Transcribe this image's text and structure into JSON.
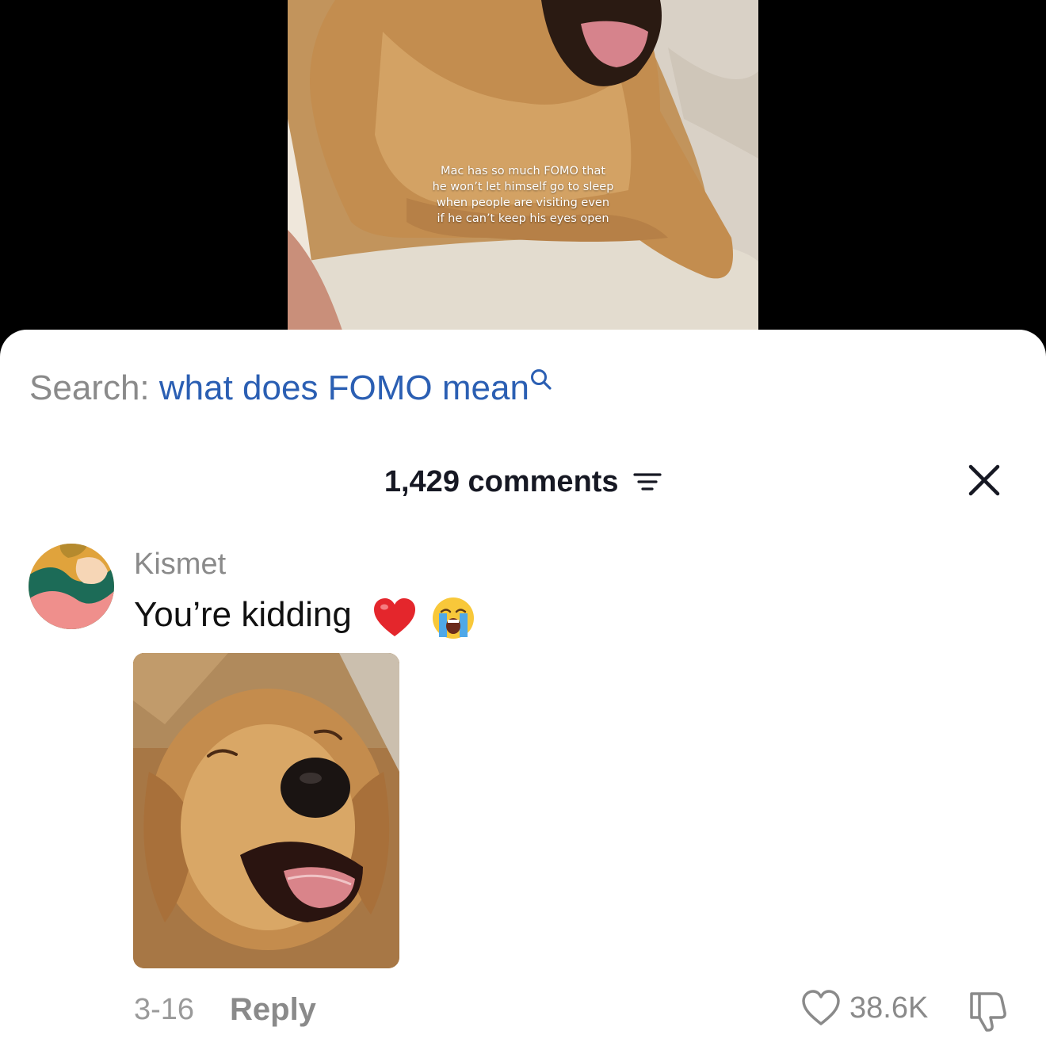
{
  "video": {
    "caption_lines": [
      "Mac has so much FOMO that",
      "he won’t let himself go to sleep",
      "when people are visiting even",
      "if he can’t keep his eyes open"
    ]
  },
  "search": {
    "label": "Search:",
    "query": "what does FOMO mean",
    "icon": "search-icon"
  },
  "comments": {
    "count_label": "1,429 comments",
    "sort_icon": "sort-filter-icon",
    "close_icon": "close-icon"
  },
  "comment": {
    "username": "Kismet",
    "text": "You’re kidding",
    "emojis": [
      "red-heart",
      "loudly-crying-face"
    ],
    "date": "3-16",
    "reply_label": "Reply",
    "like_count": "38.6K",
    "like_icon": "heart-outline-icon",
    "dislike_icon": "thumbs-down-icon"
  },
  "colors": {
    "search_query": "#2b5fb3",
    "muted_text": "#8a8a8a",
    "sheet_background": "#ffffff",
    "outer_background": "#000000"
  }
}
